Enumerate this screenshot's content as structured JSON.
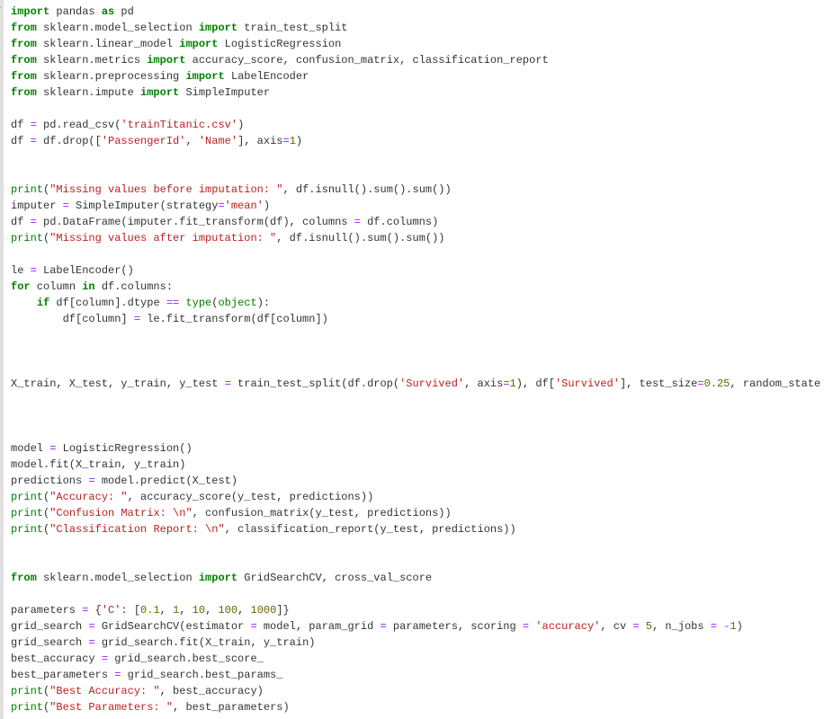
{
  "code_lines": [
    [
      [
        "kw",
        "import"
      ],
      [
        "nm",
        " pandas "
      ],
      [
        "kw",
        "as"
      ],
      [
        "nm",
        " pd"
      ]
    ],
    [
      [
        "kw",
        "from"
      ],
      [
        "nm",
        " sklearn.model_selection "
      ],
      [
        "kw",
        "import"
      ],
      [
        "nm",
        " train_test_split"
      ]
    ],
    [
      [
        "kw",
        "from"
      ],
      [
        "nm",
        " sklearn.linear_model "
      ],
      [
        "kw",
        "import"
      ],
      [
        "nm",
        " LogisticRegression"
      ]
    ],
    [
      [
        "kw",
        "from"
      ],
      [
        "nm",
        " sklearn.metrics "
      ],
      [
        "kw",
        "import"
      ],
      [
        "nm",
        " accuracy_score, confusion_matrix, classification_report"
      ]
    ],
    [
      [
        "kw",
        "from"
      ],
      [
        "nm",
        " sklearn.preprocessing "
      ],
      [
        "kw",
        "import"
      ],
      [
        "nm",
        " LabelEncoder"
      ]
    ],
    [
      [
        "kw",
        "from"
      ],
      [
        "nm",
        " sklearn.impute "
      ],
      [
        "kw",
        "import"
      ],
      [
        "nm",
        " SimpleImputer"
      ]
    ],
    [],
    [
      [
        "nm",
        "df "
      ],
      [
        "op",
        "="
      ],
      [
        "nm",
        " pd.read_csv("
      ],
      [
        "str",
        "'trainTitanic.csv'"
      ],
      [
        "nm",
        ")"
      ]
    ],
    [
      [
        "nm",
        "df "
      ],
      [
        "op",
        "="
      ],
      [
        "nm",
        " df.drop(["
      ],
      [
        "str",
        "'PassengerId'"
      ],
      [
        "nm",
        ", "
      ],
      [
        "str",
        "'Name'"
      ],
      [
        "nm",
        "], axis"
      ],
      [
        "op",
        "="
      ],
      [
        "num",
        "1"
      ],
      [
        "nm",
        ")"
      ]
    ],
    [],
    [],
    [
      [
        "builtin",
        "print"
      ],
      [
        "nm",
        "("
      ],
      [
        "str",
        "\"Missing values before imputation: \""
      ],
      [
        "nm",
        ", df.isnull().sum().sum())"
      ]
    ],
    [
      [
        "nm",
        "imputer "
      ],
      [
        "op",
        "="
      ],
      [
        "nm",
        " SimpleImputer(strategy"
      ],
      [
        "op",
        "="
      ],
      [
        "str",
        "'mean'"
      ],
      [
        "nm",
        ")"
      ]
    ],
    [
      [
        "nm",
        "df "
      ],
      [
        "op",
        "="
      ],
      [
        "nm",
        " pd.DataFrame(imputer.fit_transform(df), columns "
      ],
      [
        "op",
        "="
      ],
      [
        "nm",
        " df.columns)"
      ]
    ],
    [
      [
        "builtin",
        "print"
      ],
      [
        "nm",
        "("
      ],
      [
        "str",
        "\"Missing values after imputation: \""
      ],
      [
        "nm",
        ", df.isnull().sum().sum())"
      ]
    ],
    [],
    [
      [
        "nm",
        "le "
      ],
      [
        "op",
        "="
      ],
      [
        "nm",
        " LabelEncoder()"
      ]
    ],
    [
      [
        "kw",
        "for"
      ],
      [
        "nm",
        " column "
      ],
      [
        "kw",
        "in"
      ],
      [
        "nm",
        " df.columns:"
      ]
    ],
    [
      [
        "nm",
        "    "
      ],
      [
        "kw",
        "if"
      ],
      [
        "nm",
        " df[column].dtype "
      ],
      [
        "op",
        "=="
      ],
      [
        "nm",
        " "
      ],
      [
        "builtin",
        "type"
      ],
      [
        "nm",
        "("
      ],
      [
        "builtin",
        "object"
      ],
      [
        "nm",
        "):"
      ]
    ],
    [
      [
        "nm",
        "        df[column] "
      ],
      [
        "op",
        "="
      ],
      [
        "nm",
        " le.fit_transform(df[column])"
      ]
    ],
    [],
    [],
    [],
    [
      [
        "nm",
        "X_train, X_test, y_train, y_test "
      ],
      [
        "op",
        "="
      ],
      [
        "nm",
        " train_test_split(df.drop("
      ],
      [
        "str",
        "'Survived'"
      ],
      [
        "nm",
        ", axis"
      ],
      [
        "op",
        "="
      ],
      [
        "num",
        "1"
      ],
      [
        "nm",
        "), df["
      ],
      [
        "str",
        "'Survived'"
      ],
      [
        "nm",
        "], test_size"
      ],
      [
        "op",
        "="
      ],
      [
        "num",
        "0.25"
      ],
      [
        "nm",
        ", random_state"
      ]
    ],
    [],
    [],
    [],
    [
      [
        "nm",
        "model "
      ],
      [
        "op",
        "="
      ],
      [
        "nm",
        " LogisticRegression()"
      ]
    ],
    [
      [
        "nm",
        "model.fit(X_train, y_train)"
      ]
    ],
    [
      [
        "nm",
        "predictions "
      ],
      [
        "op",
        "="
      ],
      [
        "nm",
        " model.predict(X_test)"
      ]
    ],
    [
      [
        "builtin",
        "print"
      ],
      [
        "nm",
        "("
      ],
      [
        "str",
        "\"Accuracy: \""
      ],
      [
        "nm",
        ", accuracy_score(y_test, predictions))"
      ]
    ],
    [
      [
        "builtin",
        "print"
      ],
      [
        "nm",
        "("
      ],
      [
        "str",
        "\"Confusion Matrix: \\n\""
      ],
      [
        "nm",
        ", confusion_matrix(y_test, predictions))"
      ]
    ],
    [
      [
        "builtin",
        "print"
      ],
      [
        "nm",
        "("
      ],
      [
        "str",
        "\"Classification Report: \\n\""
      ],
      [
        "nm",
        ", classification_report(y_test, predictions))"
      ]
    ],
    [],
    [],
    [
      [
        "kw",
        "from"
      ],
      [
        "nm",
        " sklearn.model_selection "
      ],
      [
        "kw",
        "import"
      ],
      [
        "nm",
        " GridSearchCV, cross_val_score"
      ]
    ],
    [],
    [
      [
        "nm",
        "parameters "
      ],
      [
        "op",
        "="
      ],
      [
        "nm",
        " {"
      ],
      [
        "str",
        "'C'"
      ],
      [
        "nm",
        ": ["
      ],
      [
        "num",
        "0.1"
      ],
      [
        "nm",
        ", "
      ],
      [
        "num",
        "1"
      ],
      [
        "nm",
        ", "
      ],
      [
        "num",
        "10"
      ],
      [
        "nm",
        ", "
      ],
      [
        "num",
        "100"
      ],
      [
        "nm",
        ", "
      ],
      [
        "num",
        "1000"
      ],
      [
        "nm",
        "]}"
      ]
    ],
    [
      [
        "nm",
        "grid_search "
      ],
      [
        "op",
        "="
      ],
      [
        "nm",
        " GridSearchCV(estimator "
      ],
      [
        "op",
        "="
      ],
      [
        "nm",
        " model, param_grid "
      ],
      [
        "op",
        "="
      ],
      [
        "nm",
        " parameters, scoring "
      ],
      [
        "op",
        "="
      ],
      [
        "nm",
        " "
      ],
      [
        "str",
        "'accuracy'"
      ],
      [
        "nm",
        ", cv "
      ],
      [
        "op",
        "="
      ],
      [
        "nm",
        " "
      ],
      [
        "num",
        "5"
      ],
      [
        "nm",
        ", n_jobs "
      ],
      [
        "op",
        "="
      ],
      [
        "nm",
        " "
      ],
      [
        "op",
        "-"
      ],
      [
        "num",
        "1"
      ],
      [
        "nm",
        ")"
      ]
    ],
    [
      [
        "nm",
        "grid_search "
      ],
      [
        "op",
        "="
      ],
      [
        "nm",
        " grid_search.fit(X_train, y_train)"
      ]
    ],
    [
      [
        "nm",
        "best_accuracy "
      ],
      [
        "op",
        "="
      ],
      [
        "nm",
        " grid_search.best_score_"
      ]
    ],
    [
      [
        "nm",
        "best_parameters "
      ],
      [
        "op",
        "="
      ],
      [
        "nm",
        " grid_search.best_params_"
      ]
    ],
    [
      [
        "builtin",
        "print"
      ],
      [
        "nm",
        "("
      ],
      [
        "str",
        "\"Best Accuracy: \""
      ],
      [
        "nm",
        ", best_accuracy)"
      ]
    ],
    [
      [
        "builtin",
        "print"
      ],
      [
        "nm",
        "("
      ],
      [
        "str",
        "\"Best Parameters: \""
      ],
      [
        "nm",
        ", best_parameters)"
      ]
    ]
  ],
  "run_marker": "▸"
}
